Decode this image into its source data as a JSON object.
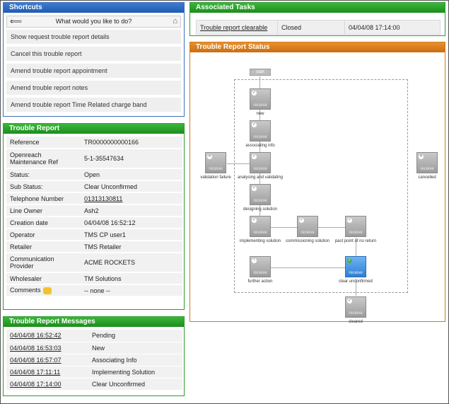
{
  "shortcuts": {
    "title": "Shortcuts",
    "search_placeholder": "What would you like to do?",
    "items": [
      "Show request trouble report details",
      "Cancel this trouble report",
      "Amend trouble report appointment",
      "Amend trouble report notes",
      "Amend trouble report Time Related charge band"
    ]
  },
  "report": {
    "title": "Trouble Report",
    "rows": [
      {
        "label": "Reference",
        "value": "TR0000000000166"
      },
      {
        "label": "Openreach Maintenance Ref",
        "value": "5-1-35547634"
      },
      {
        "label": "Status:",
        "value": "Open"
      },
      {
        "label": "Sub Status:",
        "value": "Clear Unconfirmed"
      },
      {
        "label": "Telephone Number",
        "value": "01313130811"
      },
      {
        "label": "Line Owner",
        "value": "Ash2"
      },
      {
        "label": "Creation date",
        "value": "04/04/08 16:52:12"
      },
      {
        "label": "Operator",
        "value": "TMS CP user1"
      },
      {
        "label": "Retailer",
        "value": "TMS Retailer"
      },
      {
        "label": "Communication Provider",
        "value": "ACME ROCKETS"
      },
      {
        "label": "Wholesaler",
        "value": "TM Solutions"
      },
      {
        "label": "Comments",
        "value": "-- none --"
      }
    ]
  },
  "messages": {
    "title": "Trouble Report Messages",
    "rows": [
      {
        "time": "04/04/08 16:52:42",
        "text": "Pending"
      },
      {
        "time": "04/04/08 16:53:03",
        "text": "New"
      },
      {
        "time": "04/04/08 16:57:07",
        "text": "Associating Info"
      },
      {
        "time": "04/04/08 17:11:11",
        "text": "Implementing Solution"
      },
      {
        "time": "04/04/08 17:14:00",
        "text": "Clear Unconfirmed"
      }
    ]
  },
  "tasks": {
    "title": "Associated Tasks",
    "row": {
      "name": "Trouble report clearable",
      "state": "Closed",
      "time": "04/04/08 17:14:00"
    }
  },
  "status": {
    "title": "Trouble Report Status",
    "start": "start",
    "node_text": "receive",
    "labels": {
      "new": "new",
      "associating": "associating info",
      "analysing": "analysing and validating",
      "designing": "designing solution",
      "implementing": "implementing solution",
      "commissioning": "commissioning solution",
      "past_point": "past point of no return",
      "further": "further action",
      "clear_unconfirmed": "clear unconfirmed",
      "cleared": "cleared",
      "validation_failure": "validation failure",
      "cancelled": "cancelled"
    }
  },
  "colors": {
    "shortcuts_header": "#2f6bc4",
    "green_header": "#25a025",
    "status_header": "#dd8320",
    "active_node": "#3a8ae0"
  }
}
